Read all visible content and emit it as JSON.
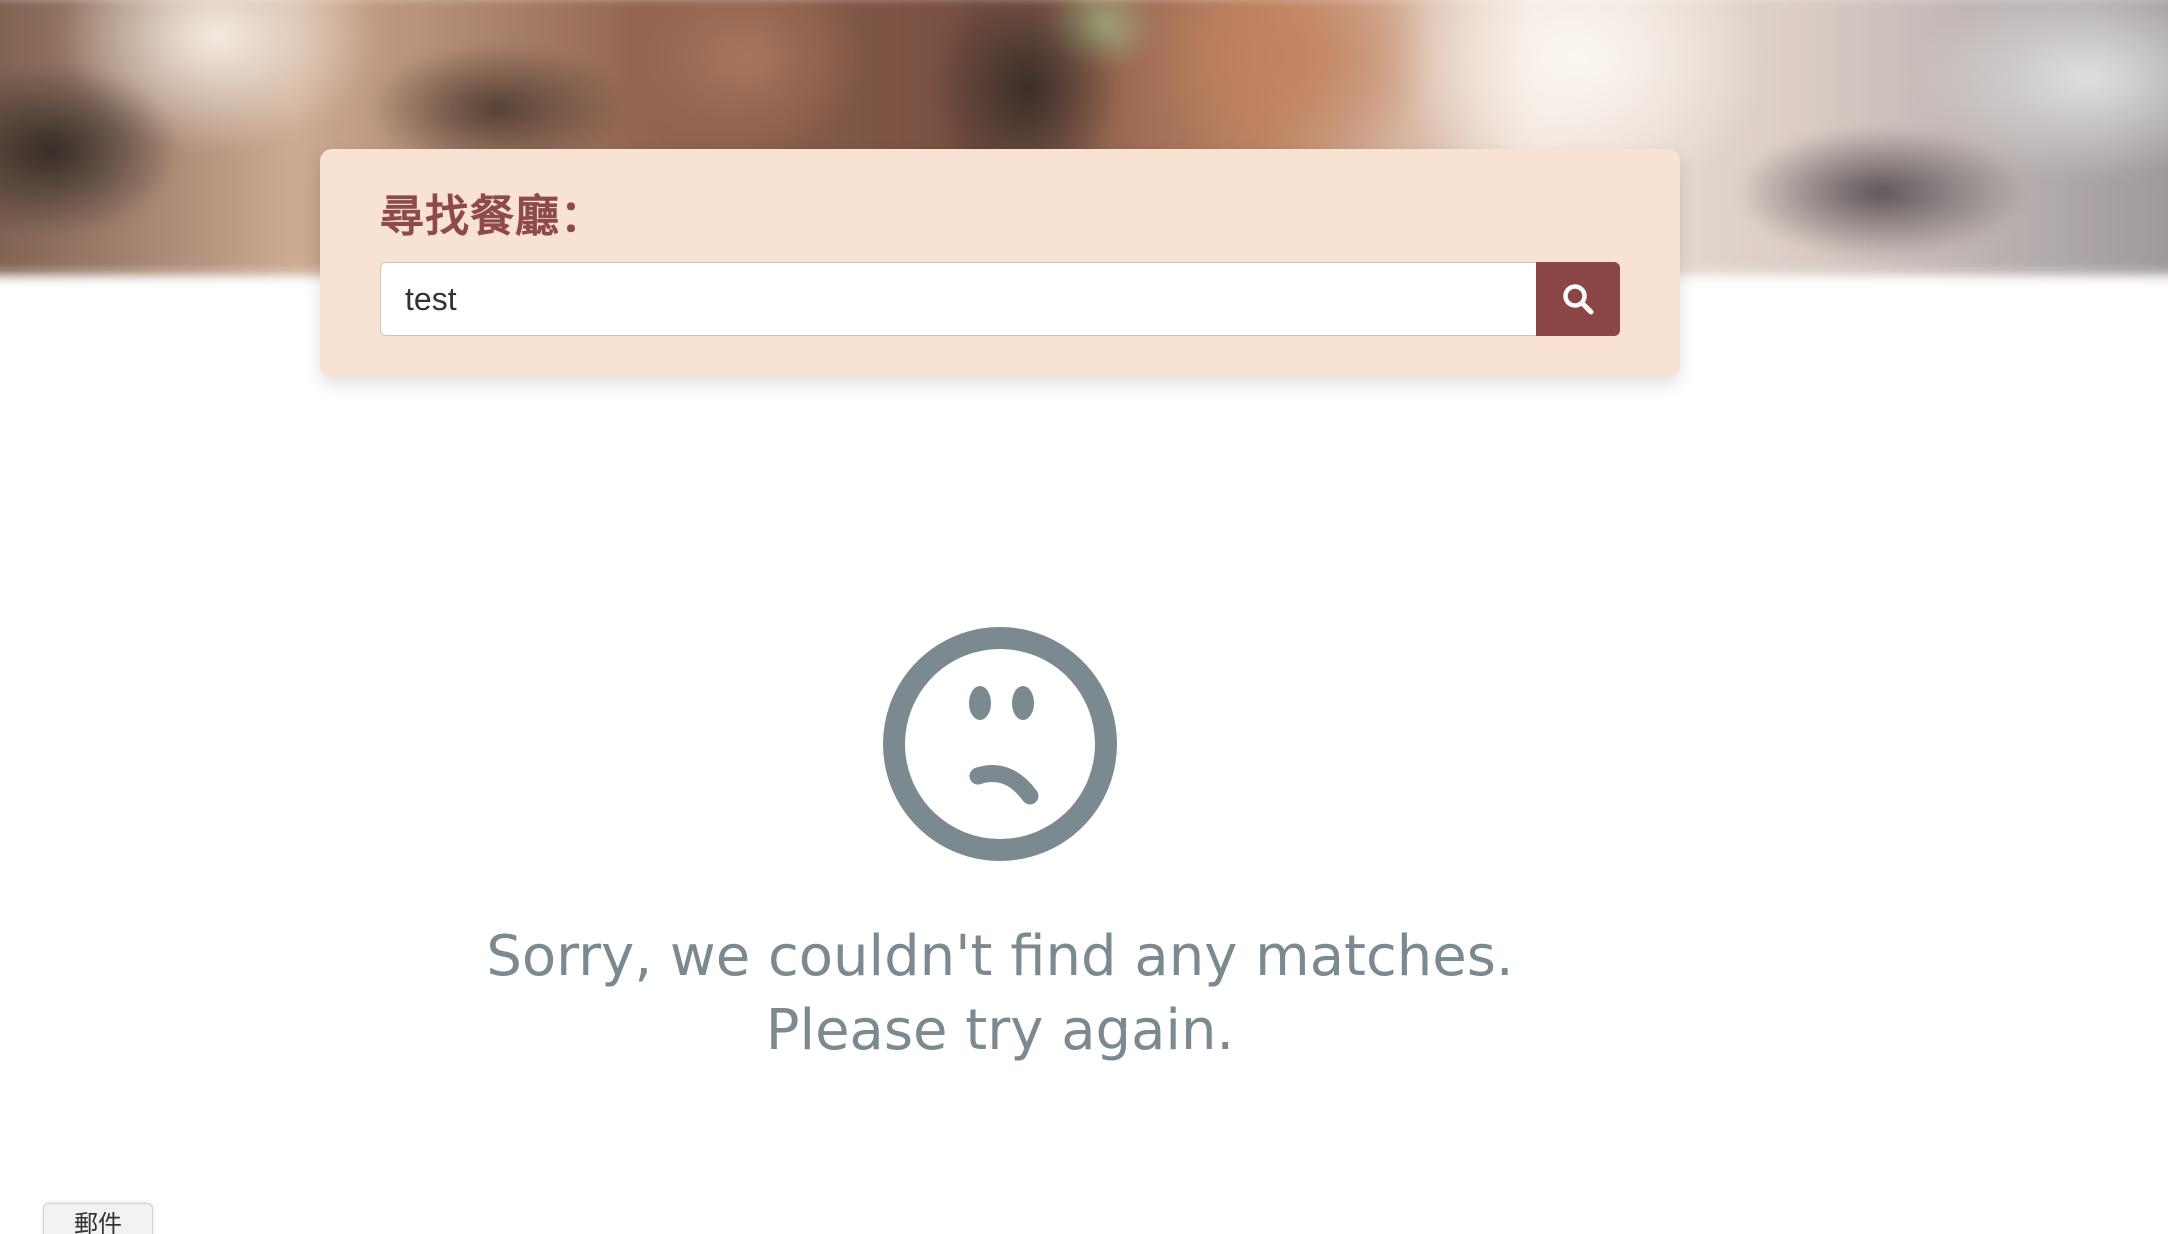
{
  "search": {
    "title": "尋找餐廳：",
    "value": "test",
    "button_icon": "search-icon"
  },
  "no_results": {
    "icon": "sad-face-icon",
    "line1": "Sorry, we couldn't find any matches.",
    "line2": "Please try again."
  },
  "mail_tab": {
    "label": "郵件"
  },
  "colors": {
    "panel_bg": "#f7e2d3",
    "accent": "#8a4644",
    "title": "#8e4a48",
    "message": "#7b8a90"
  }
}
